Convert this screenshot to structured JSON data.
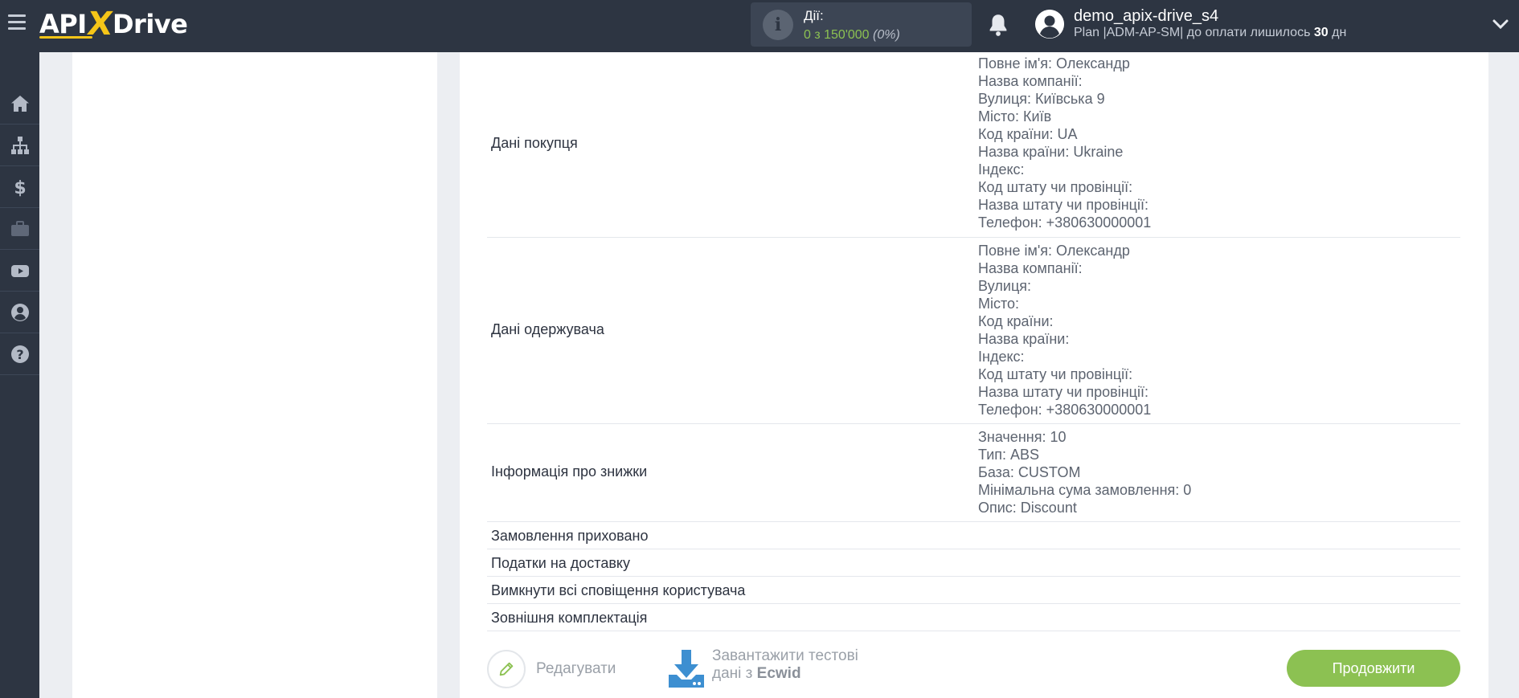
{
  "header": {
    "logo_left": "API",
    "logo_x": "X",
    "logo_right": "Drive",
    "actions_label": "Дії:",
    "actions_value": "0 з 150'000",
    "actions_percent": "(0%)",
    "username": "demo_apix-drive_s4",
    "plan_prefix": "Plan |ADM-AP-SM| до оплати лишилось ",
    "plan_days": "30",
    "plan_suffix": " дн"
  },
  "sidebar": {
    "items": [
      "home-icon",
      "sitemap-icon",
      "dollar-icon",
      "briefcase-icon",
      "youtube-icon",
      "user-icon",
      "help-icon"
    ]
  },
  "rows": [
    {
      "name": "Дані покупця",
      "values": [
        "Повне ім'я: Олександр",
        "Назва компанії:",
        "Вулиця: Київська 9",
        "Місто: Київ",
        "Код країни: UA",
        "Назва країни: Ukraine",
        "Індекс:",
        "Код штату чи провінції:",
        "Назва штату чи провінції:",
        "Телефон: +380630000001"
      ]
    },
    {
      "name": "Дані одержувача",
      "values": [
        "Повне ім'я: Олександр",
        "Назва компанії:",
        "Вулиця:",
        "Місто:",
        "Код країни:",
        "Назва країни:",
        "Індекс:",
        "Код штату чи провінції:",
        "Назва штату чи провінції:",
        "Телефон: +380630000001"
      ]
    },
    {
      "name": "Інформація про знижки",
      "values": [
        "Значення: 10",
        "Тип: ABS",
        "База: CUSTOM",
        "Мінімальна сума замовлення: 0",
        "Опис: Discount"
      ]
    },
    {
      "name": "Замовлення приховано",
      "values": []
    },
    {
      "name": "Податки на доставку",
      "values": []
    },
    {
      "name": "Вимкнути всі сповіщення користувача",
      "values": []
    },
    {
      "name": "Зовнішня комплектація",
      "values": []
    }
  ],
  "footer": {
    "edit_label": "Редагувати",
    "download_line1": "Завантажити тестові",
    "download_line2_prefix": "дані з ",
    "download_source": "Ecwid",
    "continue_label": "Продовжити"
  }
}
